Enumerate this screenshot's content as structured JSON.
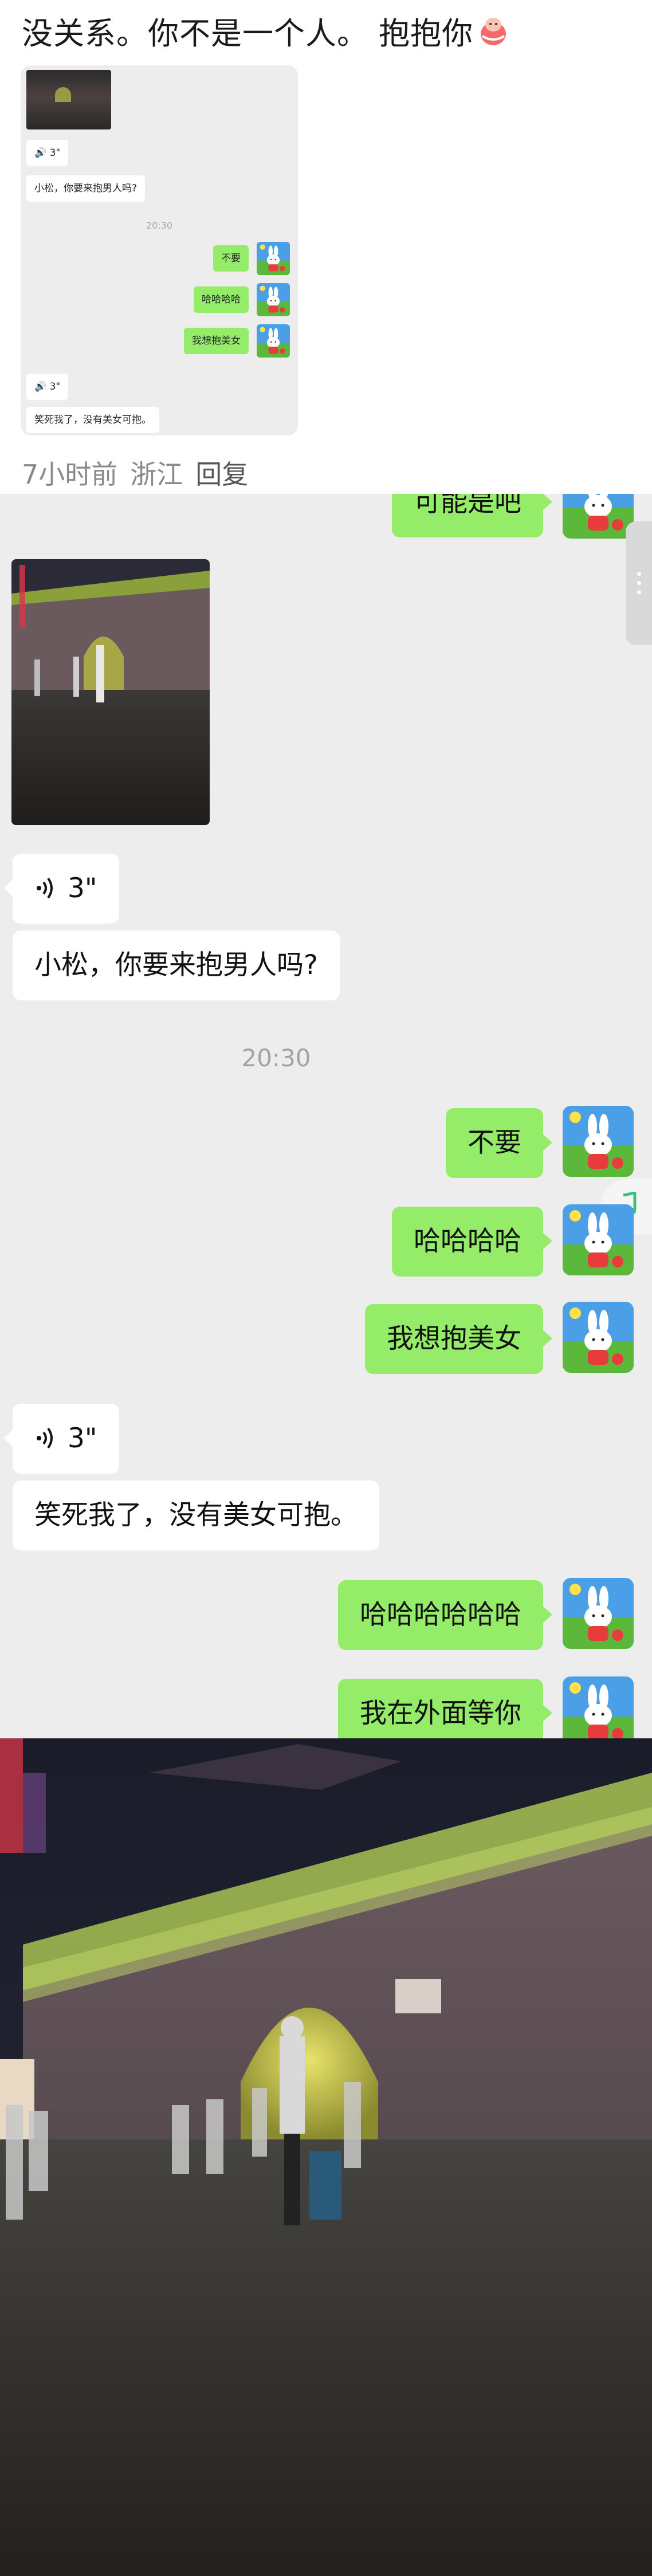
{
  "comment": {
    "text": "没关系。你不是一个人。 抱抱你",
    "emoji": "hug-emoji",
    "meta_time": "7小时前",
    "meta_location": "浙江",
    "meta_reply": "回复",
    "thumbnail": {
      "voice_1": "3\"",
      "text_1": "小松，你要来抱男人吗?",
      "time": "20:30",
      "out_1": "不要",
      "out_2": "哈哈哈哈",
      "out_3": "我想抱美女",
      "voice_2": "3\"",
      "text_2": "笑死我了，没有美女可抱。"
    }
  },
  "chat": {
    "partial_top": "可能是吧",
    "voice_1": "3\"",
    "text_1": "小松，你要来抱男人吗?",
    "time": "20:30",
    "out_1": "不要",
    "out_2": "哈哈哈哈",
    "out_3": "我想抱美女",
    "voice_2": "3\"",
    "text_2": "笑死我了，没有美女可抱。",
    "out_4": "哈哈哈哈哈哈",
    "out_5": "我在外面等你"
  },
  "icons": {
    "voice": "voice-wave-icon",
    "more": "more-vertical-icon",
    "music": "music-note-icon",
    "avatar": "bunny-avatar"
  },
  "colors": {
    "chat_bg": "#ededed",
    "bubble_out": "#95ec69",
    "bubble_in": "#ffffff",
    "time_text": "#a3a3a3",
    "meta_text": "#8a8a8a"
  }
}
